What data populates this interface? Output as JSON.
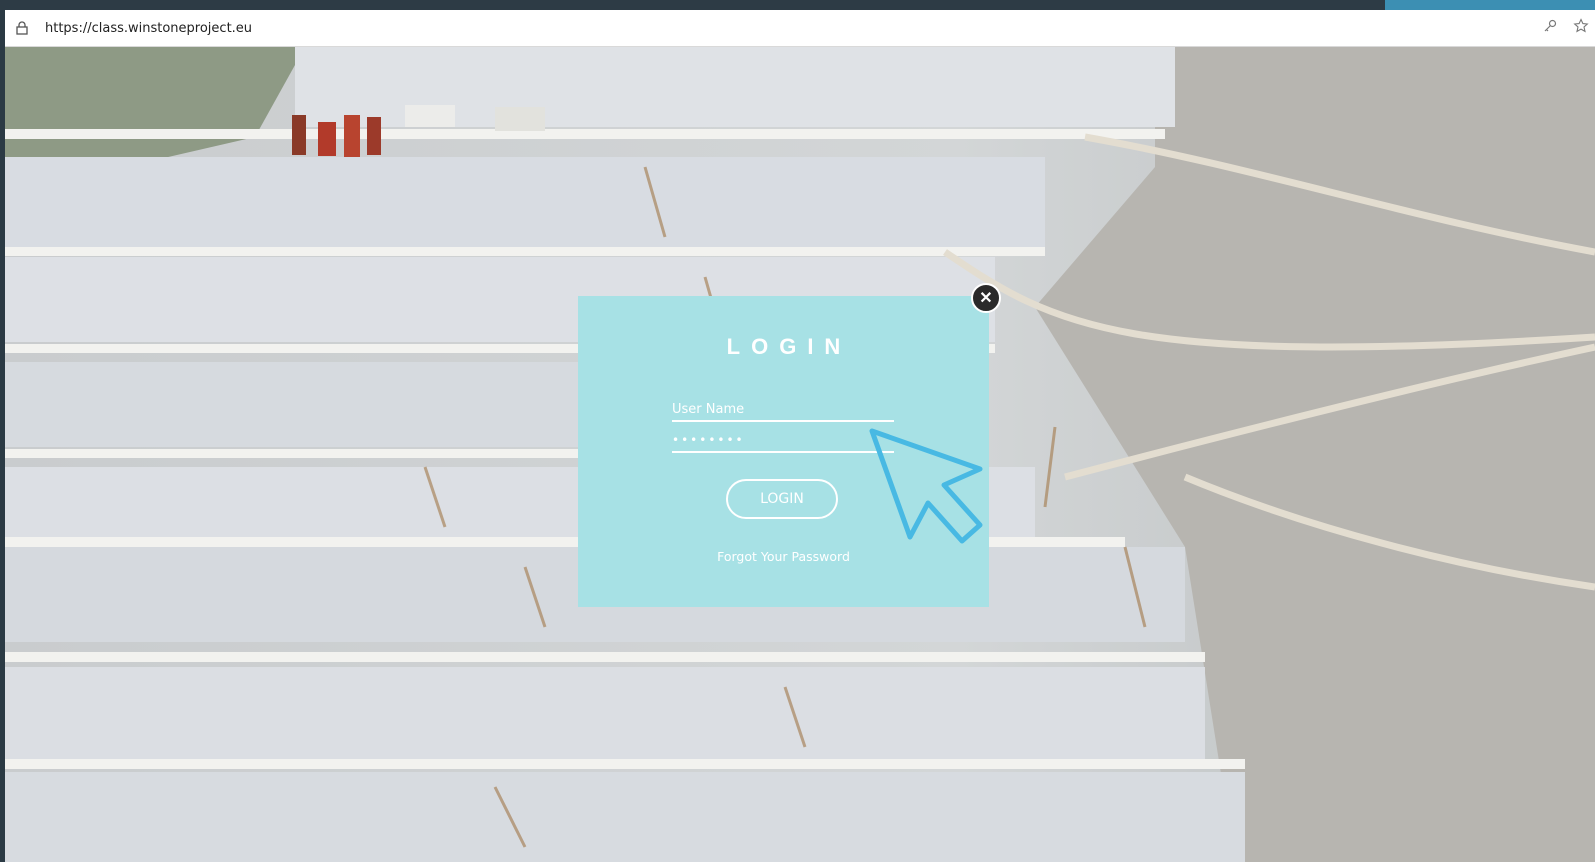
{
  "browser": {
    "url": "https://class.winstoneproject.eu",
    "lock_icon": "lock-icon",
    "key_icon": "key-icon",
    "star_icon": "star-icon"
  },
  "login_modal": {
    "title": "LOGIN",
    "username_placeholder": "User Name",
    "password_value": "••••••••",
    "login_button": "LOGIN",
    "forgot_link": "Forgot Your Password",
    "close_icon": "close-icon",
    "close_glyph": "✕",
    "background_color": "#a7e1e5"
  },
  "overlay": {
    "cursor_icon": "arrow-cursor-icon",
    "cursor_color": "#48b9e3"
  }
}
